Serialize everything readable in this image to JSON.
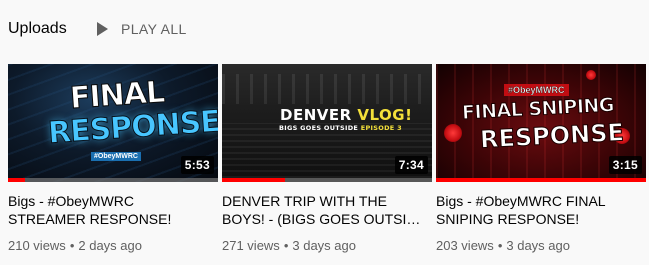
{
  "section": {
    "title": "Uploads",
    "play_all_label": "PLAY ALL"
  },
  "videos": [
    {
      "title": "Bigs - #ObeyMWRC STREAMER RESPONSE!",
      "duration": "5:53",
      "views": "210 views",
      "age": "2 days ago",
      "watched_fraction": 0.08,
      "thumbnail_text": [
        "FINAL",
        "RESPONSE",
        "#ObeyMWRC"
      ]
    },
    {
      "title": "DENVER TRIP WITH THE BOYS! - (BIGS GOES OUTSI…",
      "duration": "7:34",
      "views": "271 views",
      "age": "3 days ago",
      "watched_fraction": 0.3,
      "thumbnail_text": [
        "DENVER ",
        "VLOG!",
        "BIGS GOES OUTSIDE ",
        "EPISODE 3"
      ]
    },
    {
      "title": "Bigs - #ObeyMWRC FINAL SNIPING RESPONSE!",
      "duration": "3:15",
      "views": "203 views",
      "age": "3 days ago",
      "watched_fraction": 1.0,
      "thumbnail_text": [
        "#ObeyMWRC",
        "FINAL SNIPING",
        "RESPONSE"
      ]
    }
  ],
  "separator": "•",
  "colors": {
    "progress": "#ff0000",
    "meta_text": "#606060",
    "title_text": "#030303"
  }
}
